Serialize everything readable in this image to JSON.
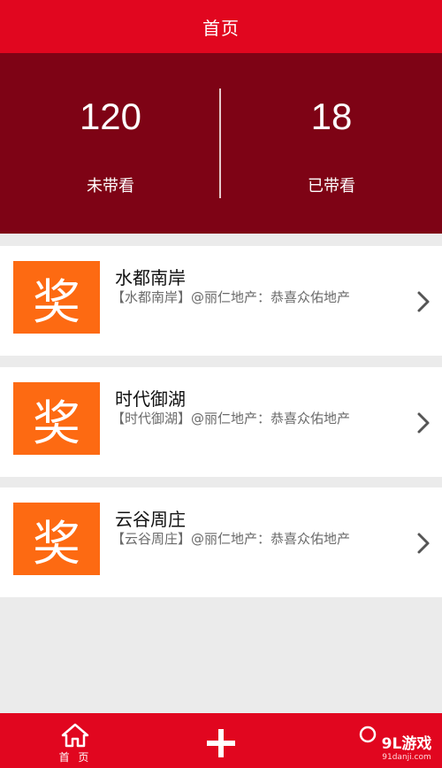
{
  "header": {
    "title": "首页"
  },
  "stats": {
    "not_viewed": {
      "count": "120",
      "label": "未带看"
    },
    "viewed": {
      "count": "18",
      "label": "已带看"
    }
  },
  "cards": [
    {
      "badge": "奖",
      "name": "水都南岸",
      "desc": "【水都南岸】@丽仁地产：恭喜众佑地产"
    },
    {
      "badge": "奖",
      "name": "时代御湖",
      "desc": "【时代御湖】@丽仁地产：恭喜众佑地产"
    },
    {
      "badge": "奖",
      "name": "云谷周庄",
      "desc": "【云谷周庄】@丽仁地产：恭喜众佑地产"
    }
  ],
  "tabbar": {
    "home_label": "首 页"
  },
  "watermark": {
    "main": "9L游戏",
    "sub": "91danji.com"
  },
  "colors": {
    "primary_red": "#e1061f",
    "dark_red": "#7e0315",
    "badge_orange": "#fd6a12",
    "background": "#ebebeb"
  },
  "icons": {
    "home": "home-icon",
    "add": "plus-icon",
    "user": "user-icon",
    "chevron": "chevron-right-icon"
  }
}
